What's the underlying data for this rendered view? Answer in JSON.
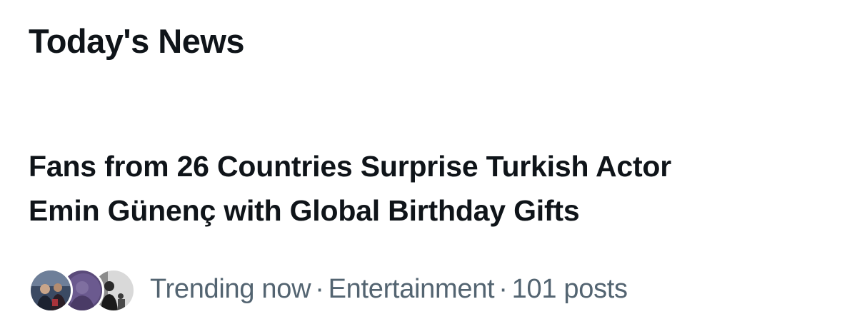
{
  "section": {
    "title": "Today's News"
  },
  "story": {
    "headline_line1": "Fans from 26 Countries Surprise Turkish Actor",
    "headline_line2": "Emin Günenç with Global Birthday Gifts",
    "status": "Trending now",
    "separator": "·",
    "category": "Entertainment",
    "post_count": "101 posts",
    "avatars": [
      {
        "icon": "user-photo-avatar",
        "accent": "#3b4a63"
      },
      {
        "icon": "user-photo-avatar",
        "accent": "#5a4a7a"
      },
      {
        "icon": "user-photo-avatar",
        "accent": "#8a8a8a"
      }
    ]
  },
  "colors": {
    "text_primary": "#0f1419",
    "text_secondary": "#536471",
    "background": "#ffffff"
  }
}
